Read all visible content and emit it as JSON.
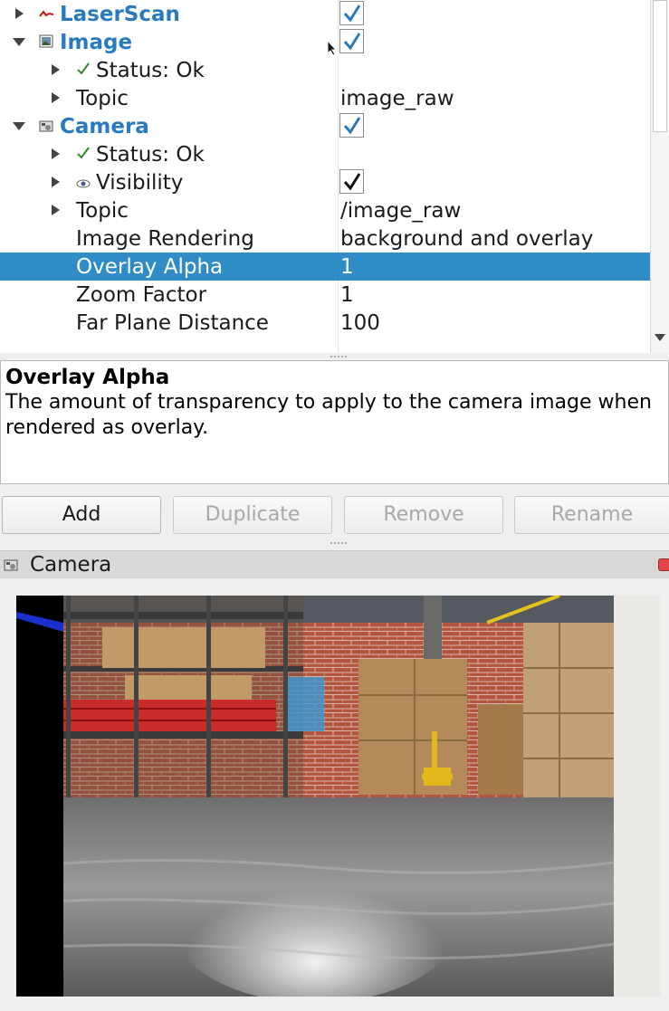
{
  "tree": {
    "rows": [
      {
        "name": "LaserScan",
        "value": ""
      },
      {
        "name": "Image",
        "value": ""
      },
      {
        "name": "Status: Ok",
        "value": ""
      },
      {
        "name": "Topic",
        "value": "image_raw"
      },
      {
        "name": "Camera",
        "value": ""
      },
      {
        "name": "Status: Ok",
        "value": ""
      },
      {
        "name": "Visibility",
        "value": ""
      },
      {
        "name": "Topic",
        "value": "/image_raw"
      },
      {
        "name": "Image Rendering",
        "value": "background and overlay"
      },
      {
        "name": "Overlay Alpha",
        "value": "1"
      },
      {
        "name": "Zoom Factor",
        "value": "1"
      },
      {
        "name": "Far Plane Distance",
        "value": "100"
      }
    ],
    "selected": "Overlay Alpha"
  },
  "description": {
    "title": "Overlay Alpha",
    "body": "The amount of transparency to apply to the camera image when rendered as overlay."
  },
  "buttons": {
    "add": "Add",
    "duplicate": "Duplicate",
    "remove": "Remove",
    "rename": "Rename"
  },
  "camera_panel": {
    "title": "Camera"
  },
  "colors": {
    "display_name": "#2a7ac0",
    "selection": "#308cc6",
    "status_ok": "#2f8a2f"
  },
  "icons": [
    "laserscan-icon",
    "image-icon",
    "camera-icon",
    "checkmark-icon",
    "eye-icon",
    "close-icon"
  ]
}
